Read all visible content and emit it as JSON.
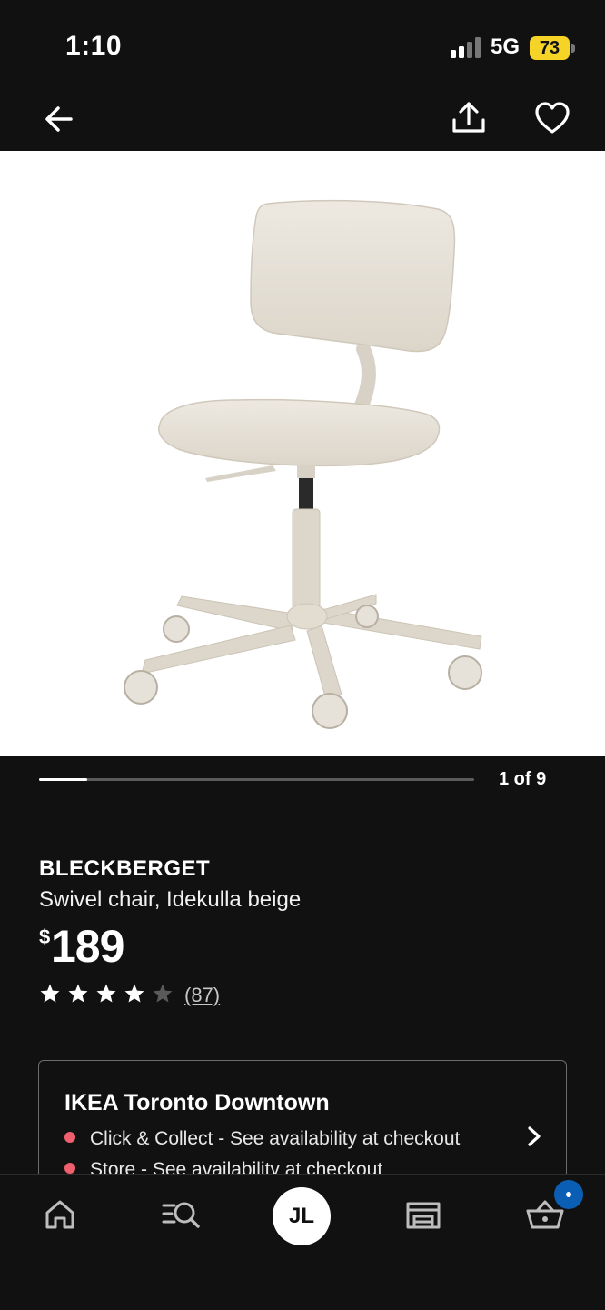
{
  "status_bar": {
    "time": "1:10",
    "network": "5G",
    "battery": "73",
    "battery_color": "#f5d327"
  },
  "nav": {
    "icons": [
      "back-arrow-icon",
      "share-icon",
      "heart-icon"
    ]
  },
  "gallery": {
    "counter": "1 of 9",
    "progress": 0.111
  },
  "product": {
    "name": "BLECKBERGET",
    "description": "Swivel chair, Idekulla beige",
    "currency": "$",
    "price": "189",
    "rating": 4,
    "rating_max": 5,
    "review_count": "(87)"
  },
  "store": {
    "name": "IKEA Toronto Downtown",
    "availability": [
      {
        "text": "Click & Collect - See availability at checkout",
        "status_color": "#ef5f6d"
      },
      {
        "text": "Store - See availability at checkout",
        "status_color": "#ef5f6d"
      }
    ]
  },
  "tab_bar": {
    "avatar_initials": "JL",
    "tabs": [
      "home-icon",
      "search-list-icon",
      "profile-avatar",
      "store-icon",
      "cart-icon"
    ],
    "cart_badge_color": "#0a5fb4"
  }
}
